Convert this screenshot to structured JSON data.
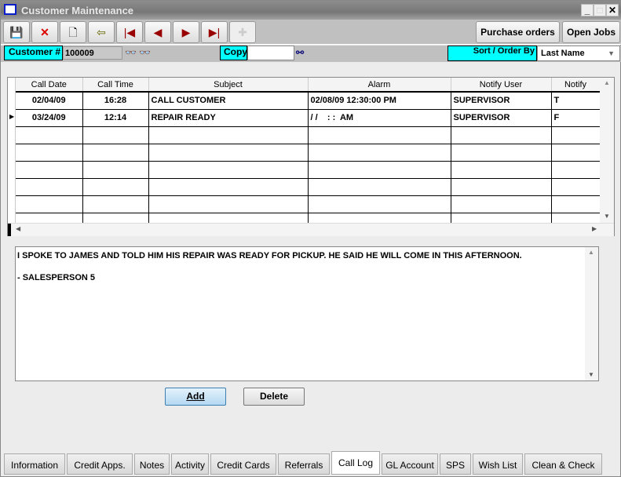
{
  "window": {
    "title": "Customer Maintenance",
    "minimize": "_",
    "close": "✕"
  },
  "toolbar": {
    "purchase_orders": "Purchase orders",
    "open_jobs": "Open Jobs"
  },
  "header": {
    "customer_label": "Customer #",
    "customer_value": "100009",
    "copy_label": "Copy",
    "copy_value": "",
    "sort_label": "Sort / Order By",
    "sort_value": "Last Name"
  },
  "grid": {
    "columns": [
      "Call Date",
      "Call Time",
      "Subject",
      "Alarm",
      "Notify User",
      "Notify"
    ],
    "rows": [
      [
        "02/04/09",
        "16:28",
        "CALL CUSTOMER",
        "02/08/09 12:30:00 PM",
        "SUPERVISOR",
        "T"
      ],
      [
        "03/24/09",
        "12:14",
        "REPAIR READY",
        "/ /    : :  AM",
        "SUPERVISOR",
        "F"
      ]
    ],
    "current_row": 1
  },
  "notes": {
    "text": "I SPOKE TO JAMES AND TOLD HIM HIS REPAIR WAS READY FOR PICKUP. HE SAID HE WILL COME IN THIS AFTERNOON.\n\n- SALESPERSON 5"
  },
  "buttons": {
    "add": "Add",
    "delete": "Delete"
  },
  "tabs": [
    "Information",
    "Credit Apps.",
    "Notes",
    "Activity",
    "Credit Cards",
    "Referrals",
    "Call Log",
    "GL Account",
    "SPS",
    "Wish List",
    "Clean & Check"
  ],
  "active_tab": "Call Log"
}
